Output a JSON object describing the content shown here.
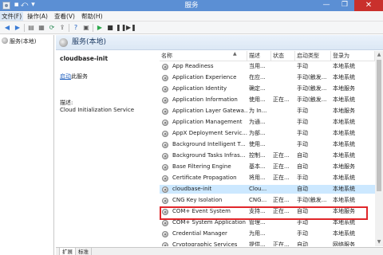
{
  "window": {
    "title": "服务",
    "minimize": "—",
    "restore": "❐",
    "close": "✕"
  },
  "menu": [
    {
      "label": "文件(F)"
    },
    {
      "label": "操作(A)"
    },
    {
      "label": "查看(V)"
    },
    {
      "label": "帮助(H)"
    }
  ],
  "toolbar": {
    "icons": [
      "back-icon",
      "forward-icon",
      "console-tree-icon",
      "properties-icon",
      "refresh-icon",
      "export-icon",
      "help-icon",
      "properties-sheet-icon",
      "start-icon",
      "stop-icon",
      "pause-icon",
      "restart-icon"
    ]
  },
  "tree": {
    "item_label": "服务(本地)"
  },
  "main": {
    "header_title": "服务(本地)",
    "selected_service": "cloudbase-init",
    "action_link": "启动",
    "action_suffix": "此服务",
    "description_label": "描述:",
    "description_text": "Cloud Initialization Service"
  },
  "columns": [
    "名称",
    "描述",
    "状态",
    "启动类型",
    "登录为"
  ],
  "rows": [
    {
      "name": "App Readiness",
      "desc": "当用...",
      "status": "",
      "startup": "手动",
      "logon": "本地系统"
    },
    {
      "name": "Application Experience",
      "desc": "在应...",
      "status": "",
      "startup": "手动(触发...",
      "logon": "本地系统"
    },
    {
      "name": "Application Identity",
      "desc": "确定...",
      "status": "",
      "startup": "手动(触发...",
      "logon": "本地服务"
    },
    {
      "name": "Application Information",
      "desc": "使用...",
      "status": "正在...",
      "startup": "手动(触发...",
      "logon": "本地系统"
    },
    {
      "name": "Application Layer Gatewa...",
      "desc": "为 In...",
      "status": "",
      "startup": "手动",
      "logon": "本地服务"
    },
    {
      "name": "Application Management",
      "desc": "为通...",
      "status": "",
      "startup": "手动",
      "logon": "本地系统"
    },
    {
      "name": "AppX Deployment Servic...",
      "desc": "为部...",
      "status": "",
      "startup": "手动",
      "logon": "本地系统"
    },
    {
      "name": "Background Intelligent T...",
      "desc": "使用...",
      "status": "",
      "startup": "手动",
      "logon": "本地系统"
    },
    {
      "name": "Background Tasks Infras...",
      "desc": "控制...",
      "status": "正在...",
      "startup": "自动",
      "logon": "本地系统"
    },
    {
      "name": "Base Filtering Engine",
      "desc": "基本...",
      "status": "正在...",
      "startup": "自动",
      "logon": "本地服务"
    },
    {
      "name": "Certificate Propagation",
      "desc": "将用...",
      "status": "正在...",
      "startup": "手动",
      "logon": "本地系统"
    },
    {
      "name": "cloudbase-init",
      "desc": "Clou...",
      "status": "",
      "startup": "自动",
      "logon": "本地系统"
    },
    {
      "name": "CNG Key Isolation",
      "desc": "CNG...",
      "status": "正在...",
      "startup": "手动(触发...",
      "logon": "本地系统"
    },
    {
      "name": "COM+ Event System",
      "desc": "支持...",
      "status": "正在...",
      "startup": "自动",
      "logon": "本地服务"
    },
    {
      "name": "COM+ System Application",
      "desc": "管理...",
      "status": "",
      "startup": "手动",
      "logon": "本地系统"
    },
    {
      "name": "Credential Manager",
      "desc": "为用...",
      "status": "",
      "startup": "手动",
      "logon": "本地系统"
    },
    {
      "name": "Cryptographic Services",
      "desc": "提供...",
      "status": "正在...",
      "startup": "自动",
      "logon": "网络服务"
    }
  ],
  "selected_index": 11,
  "tabs": [
    {
      "label": "扩展"
    },
    {
      "label": "标准"
    }
  ]
}
